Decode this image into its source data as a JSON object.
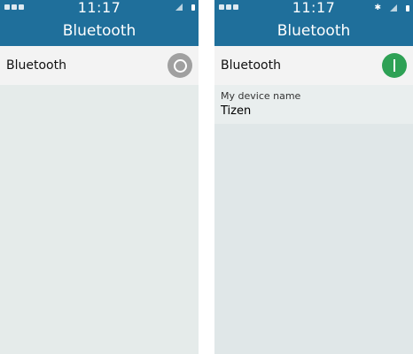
{
  "screens": [
    {
      "time": "11:17",
      "title": "Bluetooth",
      "toggle_label": "Bluetooth",
      "toggle_state": "off"
    },
    {
      "time": "11:17",
      "title": "Bluetooth",
      "toggle_label": "Bluetooth",
      "toggle_state": "on",
      "device_section_label": "My device name",
      "device_name": "Tizen"
    }
  ],
  "colors": {
    "header": "#1f6f9b",
    "toggle_on": "#2ea155",
    "toggle_off": "#a0a0a0"
  },
  "icons": {
    "status_left": [
      "notification-icon",
      "notification-icon",
      "image-icon"
    ],
    "status_right_left_screen": [
      "signal-icon",
      "battery-icon"
    ],
    "status_right_right_screen": [
      "bluetooth-icon",
      "signal-icon",
      "battery-icon"
    ]
  }
}
